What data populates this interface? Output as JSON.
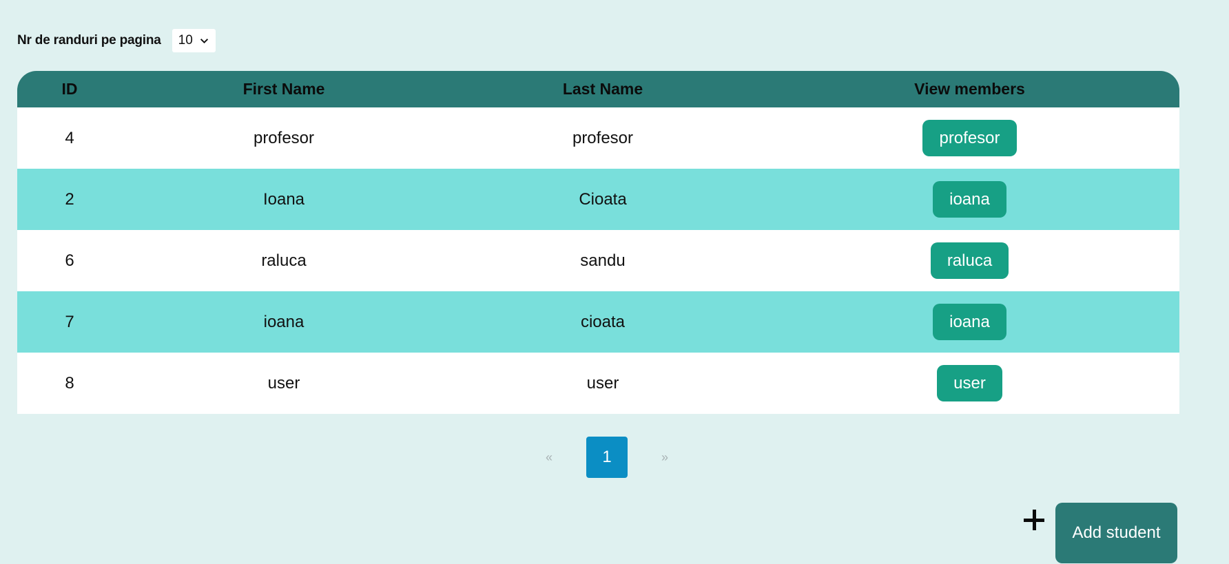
{
  "rows_per_page": {
    "label": "Nr de randuri pe pagina",
    "value": "10"
  },
  "table": {
    "headers": {
      "id": "ID",
      "first_name": "First Name",
      "last_name": "Last Name",
      "view_members": "View members"
    },
    "rows": [
      {
        "id": "4",
        "first_name": "profesor",
        "last_name": "profesor",
        "member": "profesor"
      },
      {
        "id": "2",
        "first_name": "Ioana",
        "last_name": "Cioata",
        "member": "ioana"
      },
      {
        "id": "6",
        "first_name": "raluca",
        "last_name": "sandu",
        "member": "raluca"
      },
      {
        "id": "7",
        "first_name": "ioana",
        "last_name": "cioata",
        "member": "ioana"
      },
      {
        "id": "8",
        "first_name": "user",
        "last_name": "user",
        "member": "user"
      }
    ]
  },
  "pagination": {
    "prev": "«",
    "current": "1",
    "next": "»"
  },
  "actions": {
    "plus_icon": "plus-icon",
    "add_student_label": "Add student"
  },
  "colors": {
    "page_background": "#dff1f0",
    "header_background": "#2b7a76",
    "row_alt_background": "#79dfdb",
    "member_button": "#17a085",
    "page_current": "#0b8ec4"
  }
}
